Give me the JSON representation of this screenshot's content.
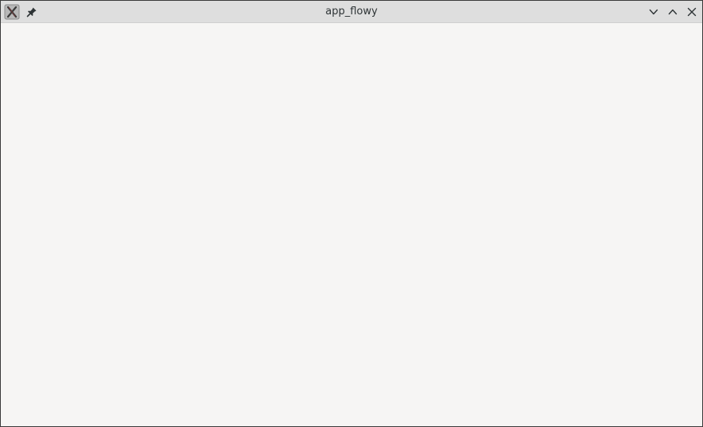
{
  "window": {
    "title": "app_flowy",
    "icons": {
      "app": "x11-app-icon",
      "pin": "pin-icon",
      "minimize": "chevron-down-icon",
      "maximize": "chevron-up-icon",
      "close": "close-icon"
    },
    "colors": {
      "titlebar": "#dedede",
      "content_background": "#f6f5f4",
      "title_text": "#2e3436"
    }
  }
}
